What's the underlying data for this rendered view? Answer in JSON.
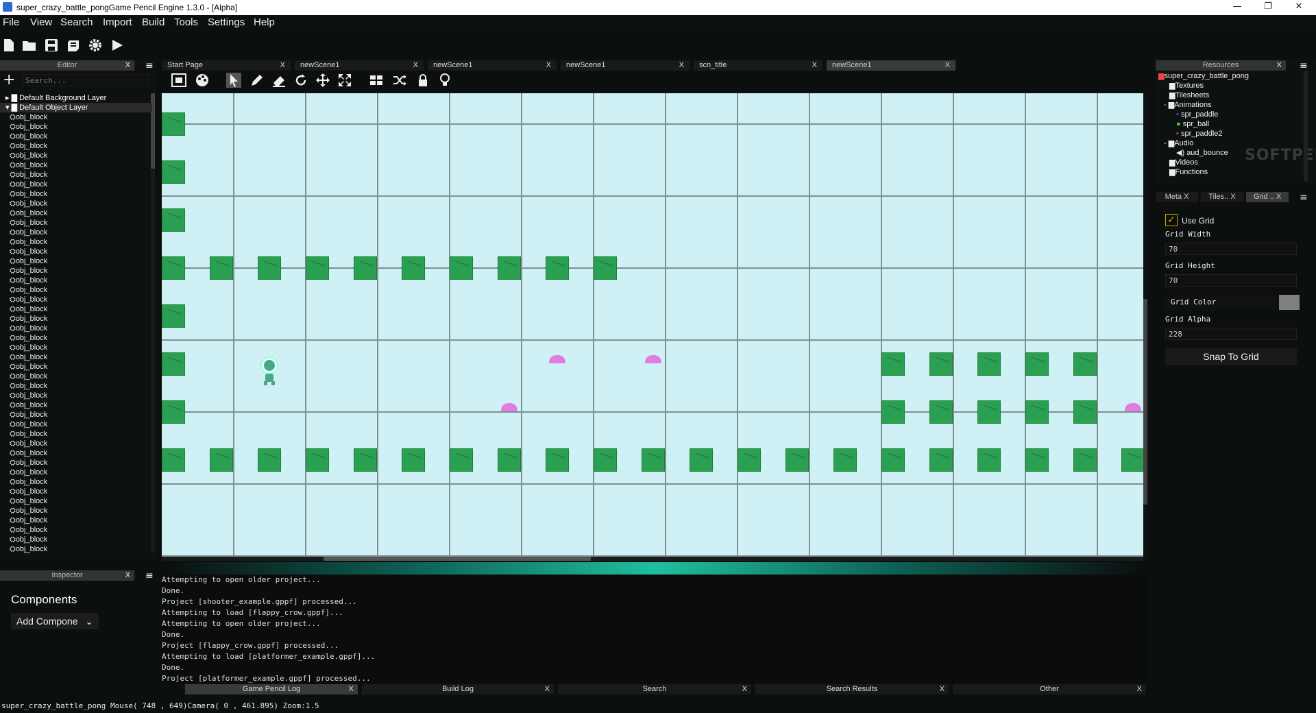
{
  "window": {
    "title": "super_crazy_battle_pongGame Pencil Engine  1.3.0 - [Alpha]",
    "minimize": "—",
    "restore": "❐",
    "close": "✕"
  },
  "menu": [
    "File",
    "View",
    "Search",
    "Import",
    "Build",
    "Tools",
    "Settings",
    "Help"
  ],
  "editor_panel": {
    "title": "Editor",
    "close": "X",
    "search_placeholder": "Search...",
    "add": "+",
    "layers": [
      "Default Background Layer",
      "Default Object Layer"
    ],
    "objects": [
      "obj_block",
      "obj_block",
      "obj_block",
      "obj_block",
      "obj_block",
      "obj_block",
      "obj_block",
      "obj_block",
      "obj_block",
      "obj_block",
      "obj_block",
      "obj_block",
      "obj_block",
      "obj_block",
      "obj_block",
      "obj_block",
      "obj_block",
      "obj_block",
      "obj_block",
      "obj_block",
      "obj_block",
      "obj_block",
      "obj_block",
      "obj_block",
      "obj_block",
      "obj_block",
      "obj_block",
      "obj_block",
      "obj_block",
      "obj_block",
      "obj_block",
      "obj_block",
      "obj_block",
      "obj_block",
      "obj_block",
      "obj_block",
      "obj_block",
      "obj_block",
      "obj_block",
      "obj_block",
      "obj_block",
      "obj_block",
      "obj_block",
      "obj_block",
      "obj_block",
      "obj_block"
    ]
  },
  "tabs": [
    {
      "label": "Start Page",
      "close": "X"
    },
    {
      "label": "newScene1",
      "close": "X"
    },
    {
      "label": "newScene1",
      "close": "X"
    },
    {
      "label": "newScene1",
      "close": "X"
    },
    {
      "label": "scn_title",
      "close": "X"
    },
    {
      "label": "newScene1",
      "close": "X"
    }
  ],
  "resources": {
    "title": "Resources",
    "close": "X",
    "project": "super_crazy_battle_pong",
    "folders": [
      "Textures",
      "Tilesheets",
      "Animations"
    ],
    "animations": [
      "spr_paddle",
      "spr_ball",
      "spr_paddle2"
    ],
    "audio_folder": "Audio",
    "audio": [
      "aud_bounce"
    ],
    "more_folders": [
      "Videos",
      "Functions"
    ],
    "watermark": "SOFTPEDIA"
  },
  "sub_tabs": [
    {
      "label": "Meta",
      "close": "X"
    },
    {
      "label": "Tiles..",
      "close": "X"
    },
    {
      "label": "Grid ..",
      "close": "X"
    }
  ],
  "grid": {
    "use_grid_label": "Use Grid",
    "width_label": "Grid Width",
    "width_value": "70",
    "height_label": "Grid Height",
    "height_value": "70",
    "color_label": "Grid Color",
    "color_value": "#808080",
    "alpha_label": "Grid Alpha",
    "alpha_value": "228",
    "snap_label": "Snap To Grid"
  },
  "inspector": {
    "title": "Inspector",
    "close": "X",
    "components_label": "Components",
    "add_component": "Add Compone"
  },
  "log_lines": [
    "Attempting to open older project...",
    "Done.",
    "Project [shooter_example.gppf] processed...",
    "Attempting to load [flappy_crow.gppf]...",
    "Attempting to open older project...",
    "Done.",
    "Project [flappy_crow.gppf] processed...",
    "Attempting to load [platformer_example.gppf]...",
    "Done.",
    "Project [platformer_example.gppf] processed..."
  ],
  "bottom_tabs": [
    {
      "label": "Game Pencil Log",
      "close": "X"
    },
    {
      "label": "Build Log",
      "close": "X"
    },
    {
      "label": "Search",
      "close": "X"
    },
    {
      "label": "Search Results",
      "close": "X"
    },
    {
      "label": "Other",
      "close": "X"
    }
  ],
  "status": "super_crazy_battle_pong Mouse( 748 , 649)Camera( 0 , 461.895) Zoom:1.5",
  "colors": {
    "scene_bg": "#cff0f5",
    "block": "#2aa052",
    "enemy": "#e07ee0",
    "accent": "#1fbf9e"
  }
}
